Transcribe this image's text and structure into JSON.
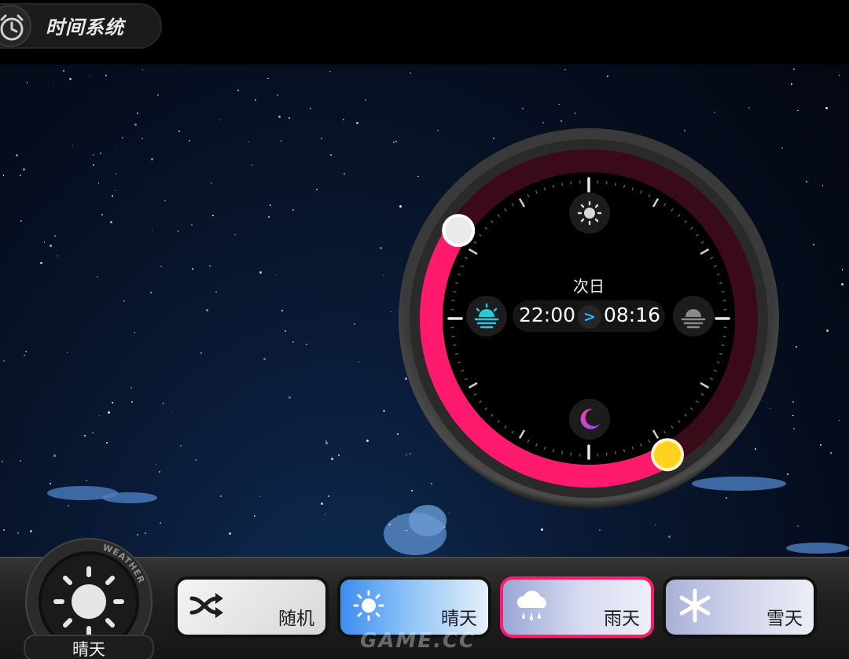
{
  "header": {
    "title": "时间系统",
    "icon": "alarm-clock-icon"
  },
  "dial": {
    "center_label": "次日",
    "start_time": "22:00",
    "end_time": "08:16",
    "arrow": ">",
    "arc_color": "#ff1a6e",
    "start_handle_color": "#ffd21f",
    "end_handle_color": "#f2f2f2",
    "icons": [
      "sun-icon",
      "sunrise-icon",
      "sunset-icon",
      "moon-icon"
    ]
  },
  "weather_knob": {
    "ring_text": "WEATHER",
    "current": "晴天",
    "icon": "sun-icon"
  },
  "weather_buttons": [
    {
      "label": "随机",
      "icon": "shuffle-icon"
    },
    {
      "label": "晴天",
      "icon": "sun-icon"
    },
    {
      "label": "雨天",
      "icon": "rain-cloud-icon",
      "selected": true
    },
    {
      "label": "雪天",
      "icon": "snowflake-icon"
    }
  ],
  "watermark": "GAME.CC"
}
